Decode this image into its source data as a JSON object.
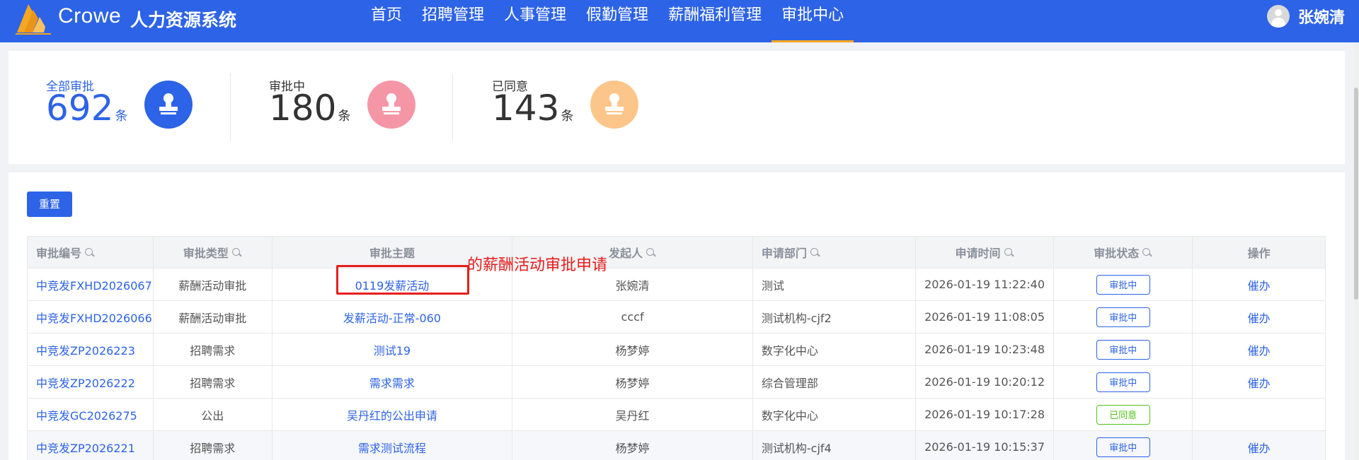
{
  "app": {
    "brand": "Crowe",
    "system_name": "人力资源系统"
  },
  "nav": {
    "items": [
      {
        "label": "首页",
        "active": false
      },
      {
        "label": "招聘管理",
        "active": false
      },
      {
        "label": "人事管理",
        "active": false
      },
      {
        "label": "假勤管理",
        "active": false
      },
      {
        "label": "薪酬福利管理",
        "active": false
      },
      {
        "label": "审批中心",
        "active": true
      }
    ]
  },
  "user": {
    "name": "张婉清"
  },
  "stats": [
    {
      "label": "全部审批",
      "value": "692",
      "unit": "条",
      "color": "#2d63e6",
      "icon": "stamp-icon"
    },
    {
      "label": "审批中",
      "value": "180",
      "unit": "条",
      "color": "#f596a6",
      "icon": "stamp-icon"
    },
    {
      "label": "已同意",
      "value": "143",
      "unit": "条",
      "color": "#fcc68a",
      "icon": "stamp-icon"
    }
  ],
  "toolbar": {
    "reset_label": "重置"
  },
  "table": {
    "columns": [
      "审批编号",
      "审批类型",
      "审批主题",
      "发起人",
      "申请部门",
      "申请时间",
      "审批状态",
      "操作"
    ],
    "rows": [
      {
        "id": "中竞发FXHD2026067",
        "type": "薪酬活动审批",
        "subject": "0119发薪活动",
        "initiator": "张婉清",
        "dept": "测试",
        "time": "2026-01-19 11:22:40",
        "status": "审批中",
        "action": "催办"
      },
      {
        "id": "中竞发FXHD2026066",
        "type": "薪酬活动审批",
        "subject": "发薪活动-正常-060",
        "initiator": "cccf",
        "dept": "测试机构-cjf2",
        "time": "2026-01-19 11:08:05",
        "status": "审批中",
        "action": "催办"
      },
      {
        "id": "中竞发ZP2026223",
        "type": "招聘需求",
        "subject": "测试19",
        "initiator": "杨梦婷",
        "dept": "数字化中心",
        "time": "2026-01-19 10:23:48",
        "status": "审批中",
        "action": "催办"
      },
      {
        "id": "中竞发ZP2026222",
        "type": "招聘需求",
        "subject": "需求需求",
        "initiator": "杨梦婷",
        "dept": "综合管理部",
        "time": "2026-01-19 10:20:12",
        "status": "审批中",
        "action": "催办"
      },
      {
        "id": "中竞发GC2026275",
        "type": "公出",
        "subject": "吴丹红的公出申请",
        "initiator": "吴丹红",
        "dept": "数字化中心",
        "time": "2026-01-19 10:17:28",
        "status": "已同意",
        "action": ""
      },
      {
        "id": "中竞发ZP2026221",
        "type": "招聘需求",
        "subject": "需求测试流程",
        "initiator": "杨梦婷",
        "dept": "测试机构-cjf4",
        "time": "2026-01-19 10:15:37",
        "status": "审批中",
        "action": "催办"
      }
    ]
  },
  "annotation": {
    "text": "的薪酬活动审批申请"
  },
  "colors": {
    "primary": "#2d63e6",
    "nav_active_underline": "#f5a623",
    "approved": "#52c41a",
    "annotation": "#e61e1e"
  }
}
